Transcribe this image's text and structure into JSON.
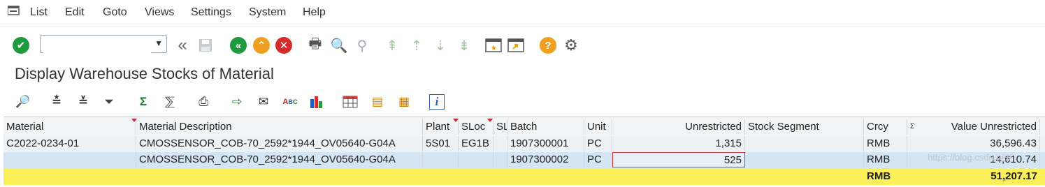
{
  "menu": [
    "List",
    "Edit",
    "Goto",
    "Views",
    "Settings",
    "System",
    "Help"
  ],
  "toolbar": {
    "command_field": {
      "value": "",
      "placeholder": ""
    }
  },
  "title": "Display Warehouse Stocks of Material",
  "grid": {
    "columns": [
      "Material",
      "Material Description",
      "Plant",
      "SLoc",
      "SL",
      "Batch",
      "Unit",
      "Unrestricted",
      "Stock Segment",
      "Crcy",
      "Σ",
      "Value Unrestricted"
    ],
    "rows": [
      {
        "material": "C2022-0234-01",
        "description": "CMOSSENSOR_COB-70_2592*1944_OV05640-G04A",
        "plant": "5S01",
        "sloc": "EG1B",
        "sl": "",
        "batch": "1907300001",
        "unit": "PC",
        "unrestricted": "1,315",
        "segment": "",
        "crcy": "RMB",
        "value": "36,596.43"
      },
      {
        "material": "",
        "description": "CMOSSENSOR_COB-70_2592*1944_OV05640-G04A",
        "plant": "",
        "sloc": "",
        "sl": "",
        "batch": "1907300002",
        "unit": "PC",
        "unrestricted": "525",
        "segment": "",
        "crcy": "RMB",
        "value": "14,610.74"
      }
    ],
    "total": {
      "crcy": "RMB",
      "value": "51,207.17"
    }
  },
  "watermark": "https://blog.csdn.net/",
  "colors": {
    "total_row": "#fcf05a",
    "selected_row": "#d5e5f3",
    "accent_green": "#1f9a3e",
    "accent_orange": "#f0a020",
    "accent_red": "#d62b2b"
  }
}
